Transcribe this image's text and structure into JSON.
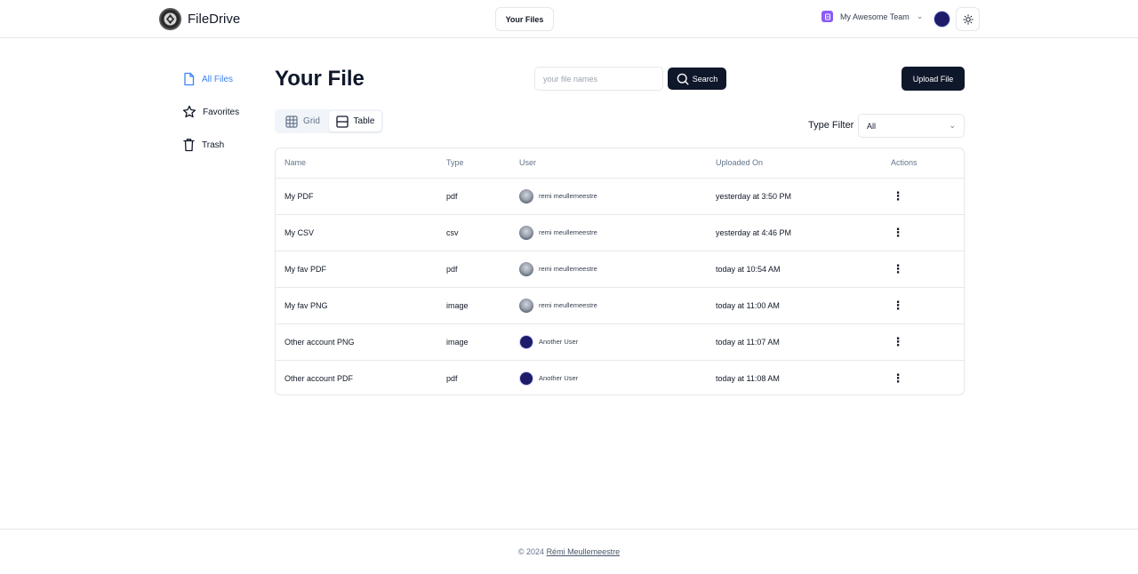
{
  "header": {
    "brand_name": "FileDrive",
    "your_files_label": "Your Files",
    "team_label": "My Awesome Team"
  },
  "sidebar": {
    "items": [
      {
        "label": "All Files",
        "icon": "file-icon",
        "active": true
      },
      {
        "label": "Favorites",
        "icon": "star-icon",
        "active": false
      },
      {
        "label": "Trash",
        "icon": "trash-icon",
        "active": false
      }
    ]
  },
  "main": {
    "title": "Your File",
    "search_placeholder": "your file names",
    "search_value": "",
    "search_button": "Search",
    "upload_button": "Upload File",
    "view_toggle": [
      {
        "label": "Grid",
        "icon": "grid-icon",
        "active": false
      },
      {
        "label": "Table",
        "icon": "table-icon",
        "active": true
      }
    ],
    "type_filter_label": "Type Filter",
    "type_filter_value": "All"
  },
  "table": {
    "columns": [
      "Name",
      "Type",
      "User",
      "Uploaded On",
      "Actions"
    ],
    "rows": [
      {
        "name": "My PDF",
        "type": "pdf",
        "user": "remi meullemeestre",
        "avatar": "remi",
        "uploaded": "yesterday at 3:50 PM"
      },
      {
        "name": "My CSV",
        "type": "csv",
        "user": "remi meullemeestre",
        "avatar": "remi",
        "uploaded": "yesterday at 4:46 PM"
      },
      {
        "name": "My fav PDF",
        "type": "pdf",
        "user": "remi meullemeestre",
        "avatar": "remi",
        "uploaded": "today at 10:54 AM"
      },
      {
        "name": "My fav PNG",
        "type": "image",
        "user": "remi meullemeestre",
        "avatar": "remi",
        "uploaded": "today at 11:00 AM"
      },
      {
        "name": "Other account PNG",
        "type": "image",
        "user": "Another User",
        "avatar": "another",
        "uploaded": "today at 11:07 AM"
      },
      {
        "name": "Other account PDF",
        "type": "pdf",
        "user": "Another User",
        "avatar": "another",
        "uploaded": "today at 11:08 AM"
      }
    ]
  },
  "footer": {
    "prefix": "© 2024",
    "author": "Rémi Meullemeestre"
  },
  "colors": {
    "accent": "#3b82f6",
    "primary_button": "#0f172a",
    "team_icon": "#8b5cf6"
  }
}
